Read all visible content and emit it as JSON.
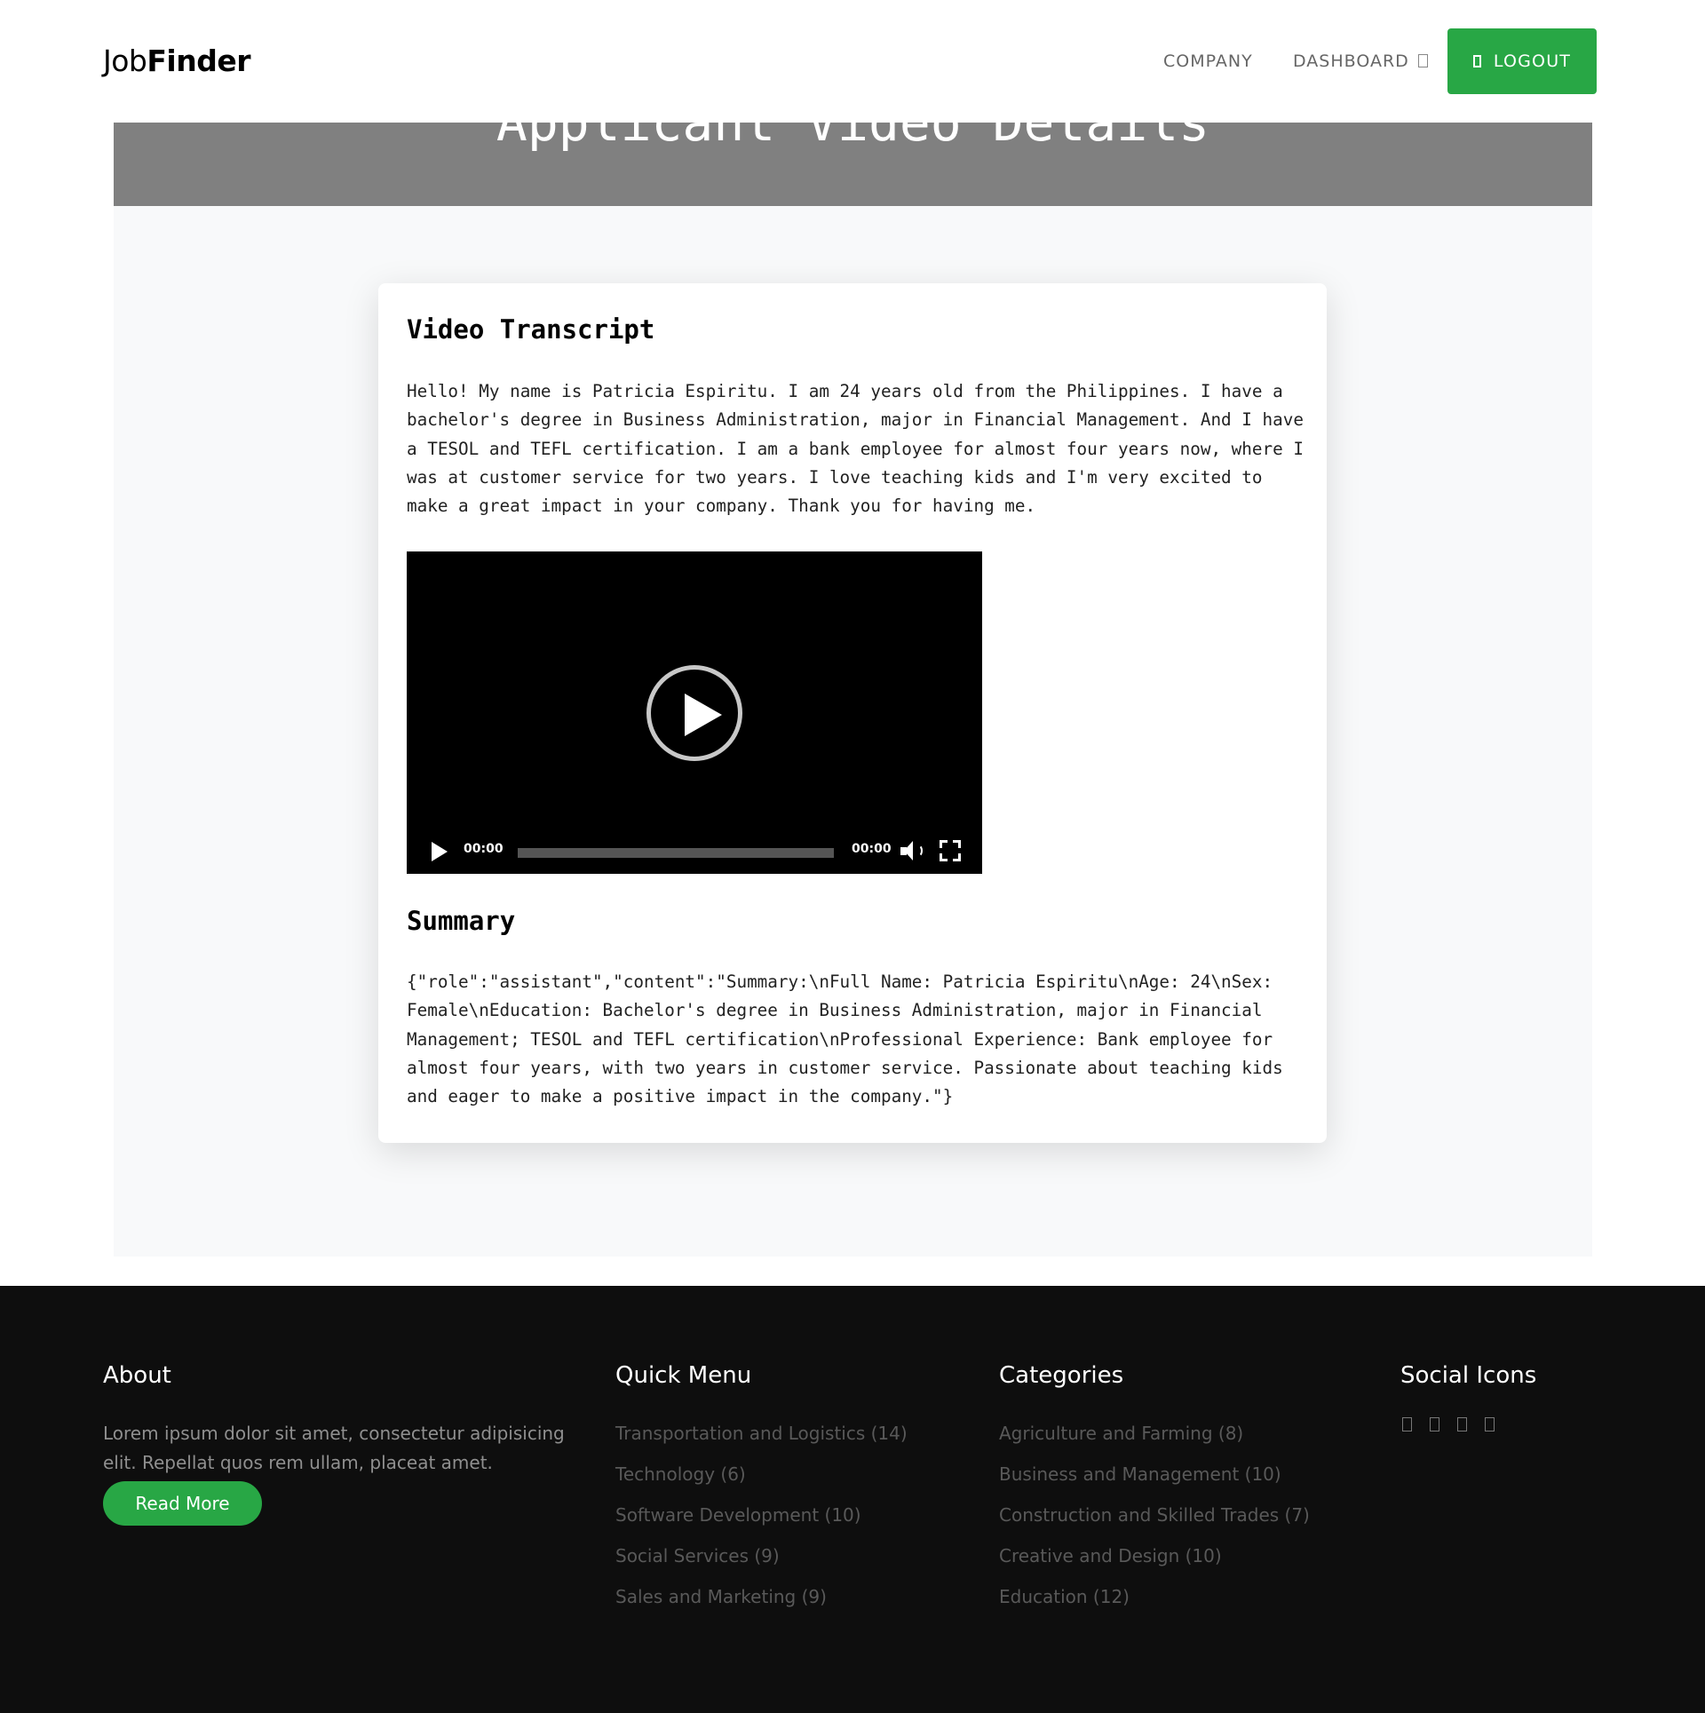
{
  "navbar": {
    "brand_light": "Job",
    "brand_bold": "Finder",
    "links": {
      "company": "COMPANY",
      "dashboard": "DASHBOARD"
    },
    "logout_label": "LOGOUT",
    "accent_color": "#28a745"
  },
  "hero": {
    "title": "Applicant Video Details"
  },
  "card": {
    "transcript_title": "Video Transcript",
    "transcript_text": "Hello! My name is Patricia Espiritu. I am 24 years old from the Philippines. I have a bachelor's degree in Business Administration, major in Financial Management. And I have a TESOL and TEFL certification. I am a bank employee for almost four years now, where I was at customer service for two years. I love teaching kids and I'm very excited to make a great impact in your company. Thank you for having me.",
    "video": {
      "current_time": "00:00",
      "duration": "00:00",
      "progress": 0
    },
    "summary_title": "Summary",
    "summary_text": "{\"role\":\"assistant\",\"content\":\"Summary:\\nFull Name: Patricia Espiritu\\nAge: 24\\nSex: Female\\nEducation: Bachelor's degree in Business Administration, major in Financial Management; TESOL and TEFL certification\\nProfessional Experience: Bank employee for almost four years, with two years in customer service. Passionate about teaching kids and eager to make a positive impact in the company.\"}"
  },
  "footer": {
    "about": {
      "heading": "About",
      "text": "Lorem ipsum dolor sit amet, consectetur adipisicing elit. Repellat quos rem ullam, placeat amet.",
      "button_label": "Read More"
    },
    "quick_menu": {
      "heading": "Quick Menu",
      "items": [
        "Transportation and Logistics (14)",
        "Technology (6)",
        "Software Development (10)",
        "Social Services (9)",
        "Sales and Marketing (9)"
      ]
    },
    "categories": {
      "heading": "Categories",
      "items": [
        "Agriculture and Farming (8)",
        "Business and Management (10)",
        "Construction and Skilled Trades (7)",
        "Creative and Design (10)",
        "Education (12)"
      ]
    },
    "social": {
      "heading": "Social Icons",
      "icons": [
        "facebook-icon",
        "twitter-icon",
        "instagram-icon",
        "linkedin-icon"
      ]
    }
  }
}
